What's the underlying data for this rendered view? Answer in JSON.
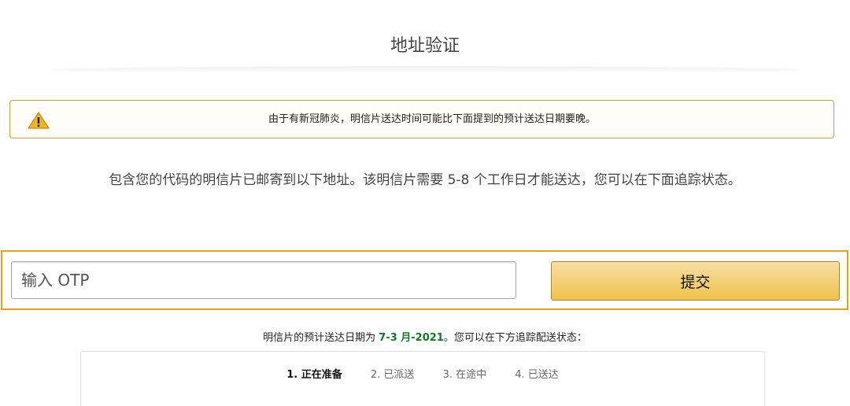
{
  "page": {
    "title": "地址验证"
  },
  "alert": {
    "icon": "warning-icon",
    "text": "由于有新冠肺炎，明信片送达时间可能比下面提到的预计送达日期要晚。",
    "border_color": "#c9a13a"
  },
  "info": {
    "text": "包含您的代码的明信片已邮寄到以下地址。该明信片需要 5-8 个工作日才能送达，您可以在下面追踪状态。"
  },
  "otp": {
    "placeholder": "输入 OTP",
    "value": "",
    "submit_label": "提交",
    "highlight_color": "#e8a317"
  },
  "delivery": {
    "prefix": "明信片的预计送达日期为 ",
    "date": "7-3 月-2021",
    "suffix": "。您可以在下方追踪配送状态：",
    "date_color": "#11782a"
  },
  "tracker": {
    "steps": [
      {
        "label": "1. 正在准备",
        "active": true
      },
      {
        "label": "2. 已派送",
        "active": false
      },
      {
        "label": "3. 在途中",
        "active": false
      },
      {
        "label": "4. 已送达",
        "active": false
      }
    ]
  }
}
